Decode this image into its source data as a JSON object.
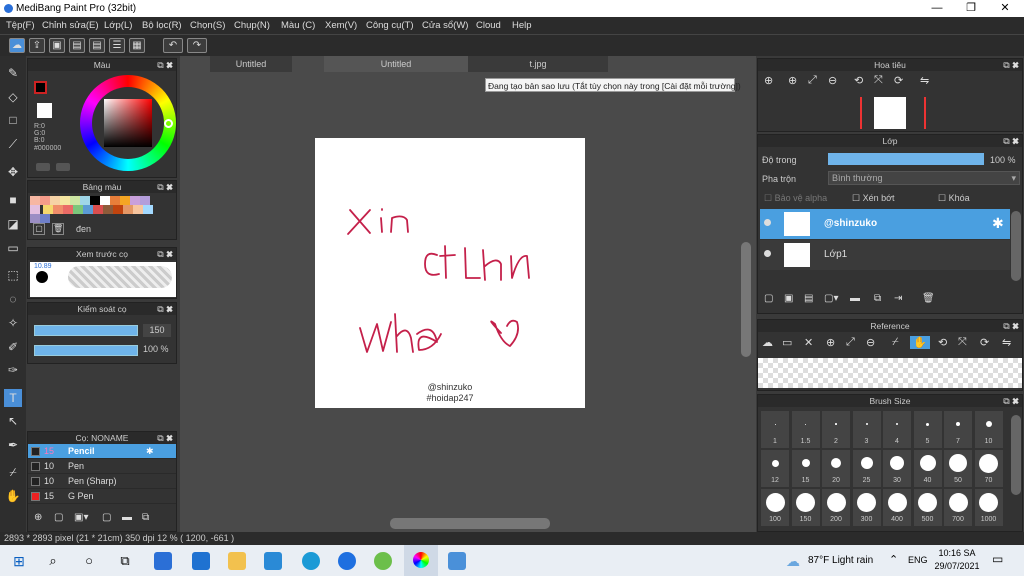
{
  "window": {
    "title": "MediBang Paint Pro (32bit)",
    "min": "—",
    "max": "❐",
    "close": "✕"
  },
  "menu": [
    "Tệp(F)",
    "Chỉnh sửa(E)",
    "Lớp(L)",
    "Bộ lọc(R)",
    "Chọn(S)",
    "Chụp(N)",
    "Màu (C)",
    "Xem(V)",
    "Công cụ(T)",
    "Cửa sổ(W)",
    "Cloud",
    "Help"
  ],
  "tabs": [
    "Untitled",
    "Untitled",
    "t.jpg"
  ],
  "tooltip": "Đang tạo bản sao lưu (Tắt tùy chọn này trong [Cài đặt mỗi trường])",
  "color_panel": {
    "title": "Màu",
    "rgb": "R:0\nG:0\nB:0",
    "hex": "#000000"
  },
  "palette_panel": {
    "title": "Bảng màu",
    "name": "đen"
  },
  "brush_preview": {
    "title": "Xem trước cọ",
    "size": "10.89"
  },
  "control_panel": {
    "title": "Kiểm soát cọ",
    "size": "150",
    "opacity": "100 %"
  },
  "brush_panel": {
    "title": "Cọ: NONAME",
    "items": [
      {
        "size": "15",
        "name": "Pencil"
      },
      {
        "size": "10",
        "name": "Pen"
      },
      {
        "size": "10",
        "name": "Pen (Sharp)"
      },
      {
        "size": "15",
        "name": "G Pen"
      }
    ]
  },
  "navigator": {
    "title": "Hoa tiêu"
  },
  "layer_panel": {
    "title": "Lớp",
    "opacity_label": "Độ trong",
    "opacity_value": "100 %",
    "blend_label": "Pha trộn",
    "blend_value": "Bình thường",
    "protect_alpha": "Bảo vệ alpha",
    "clipping": "Xén bớt",
    "lock": "Khóa",
    "layers": [
      "@shinzuko",
      "Lớp1"
    ]
  },
  "reference": {
    "title": "Reference"
  },
  "brush_size": {
    "title": "Brush Size",
    "rows": [
      [
        "1",
        "1.5",
        "2",
        "3",
        "4",
        "5",
        "7",
        "10"
      ],
      [
        "12",
        "15",
        "20",
        "25",
        "30",
        "40",
        "50",
        "70"
      ],
      [
        "100",
        "150",
        "200",
        "300",
        "400",
        "500",
        "700",
        "1000"
      ]
    ]
  },
  "canvas_text": {
    "credit1": "@shinzuko",
    "credit2": "#hoidap247"
  },
  "status": "2893 * 2893 pixel   (21 * 21cm)   350 dpi   12 %   ( 1200, -661 )",
  "taskbar": {
    "weather": "87°F  Light rain",
    "lang": "ENG",
    "time": "10:16 SA",
    "date": "29/07/2021"
  },
  "colors": {
    "accent": "#4a9fe0",
    "ink": "#c4204a"
  }
}
